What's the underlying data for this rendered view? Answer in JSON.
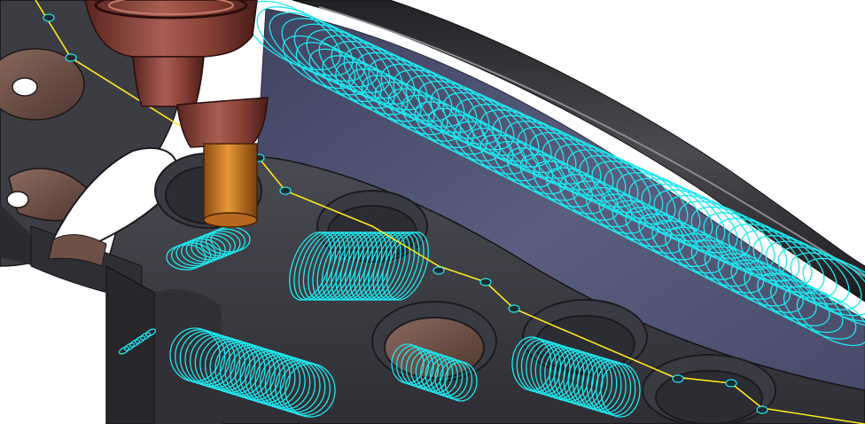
{
  "scene": {
    "description_visible": false,
    "colors": {
      "background": "#ffffff",
      "part_dark": "#3a3a40",
      "part_mid": "#55555c",
      "part_edge": "#1b1b1f",
      "floor_blue": "#4e5270",
      "floor_blue_light": "#6b6f8e",
      "bronze": "#6d5048",
      "bronze_light": "#8a6a60",
      "holder_dark": "#6a2f2a",
      "holder_light": "#a45b4f",
      "tool_orange": "#c8721c",
      "tool_light": "#e89a3e",
      "toolpath_cyan": "#1ee7ee",
      "rapid_yellow": "#ffe81a"
    },
    "icons": [
      "cnc-tool-holder",
      "end-mill-tool",
      "spiral-toolpath",
      "rapid-move-line"
    ]
  }
}
